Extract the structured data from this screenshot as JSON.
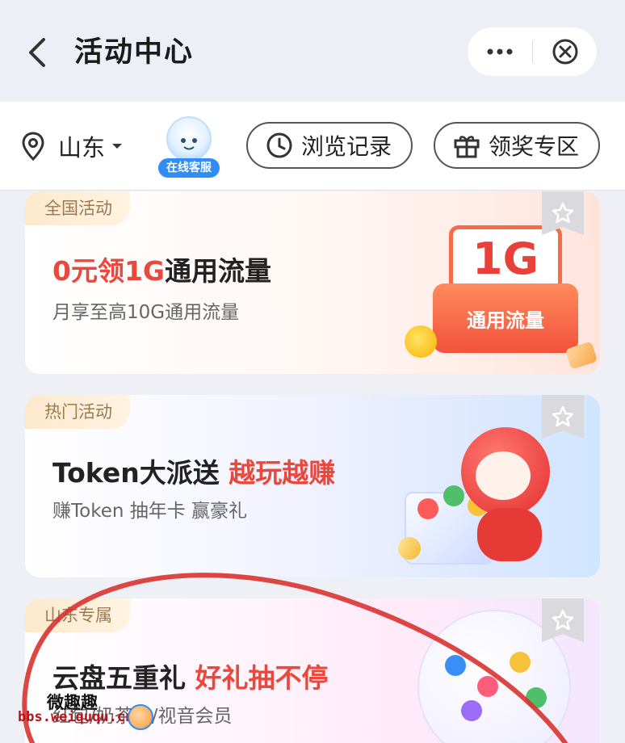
{
  "titlebar": {
    "back_icon": "chevron-left-icon",
    "title": "活动中心",
    "more_icon": "more-dots-icon",
    "close_icon": "close-circle-icon"
  },
  "toolbar": {
    "location_icon": "location-pin-icon",
    "location": "山东",
    "service_badge": "在线客服",
    "history_label": "浏览记录",
    "history_icon": "clock-icon",
    "prize_label": "领奖专区",
    "prize_icon": "gift-icon"
  },
  "cards": [
    {
      "tag": "全国活动",
      "title": "0元领1G",
      "title_rest": "通用流量",
      "subtitle": "月享至高10G通用流量",
      "art_big": "1G",
      "art_small": "通用流量"
    },
    {
      "tag": "热门活动",
      "title": "Token大派送 ",
      "title_hl": "越玩越赚",
      "subtitle": "赚Token  抽年卡  赢豪礼"
    },
    {
      "tag": "山东专属",
      "title": "云盘五重礼 ",
      "title_hl": "好礼抽不停",
      "subtitle": "红包/奶茶券/视音会员"
    }
  ],
  "watermark": {
    "line1": "微趣趣",
    "line2": "bbs.weiququ.cn"
  },
  "colors": {
    "accent_red": "#e9483d",
    "tag_text": "#9a7a53",
    "annotation_red": "#d8332f"
  }
}
